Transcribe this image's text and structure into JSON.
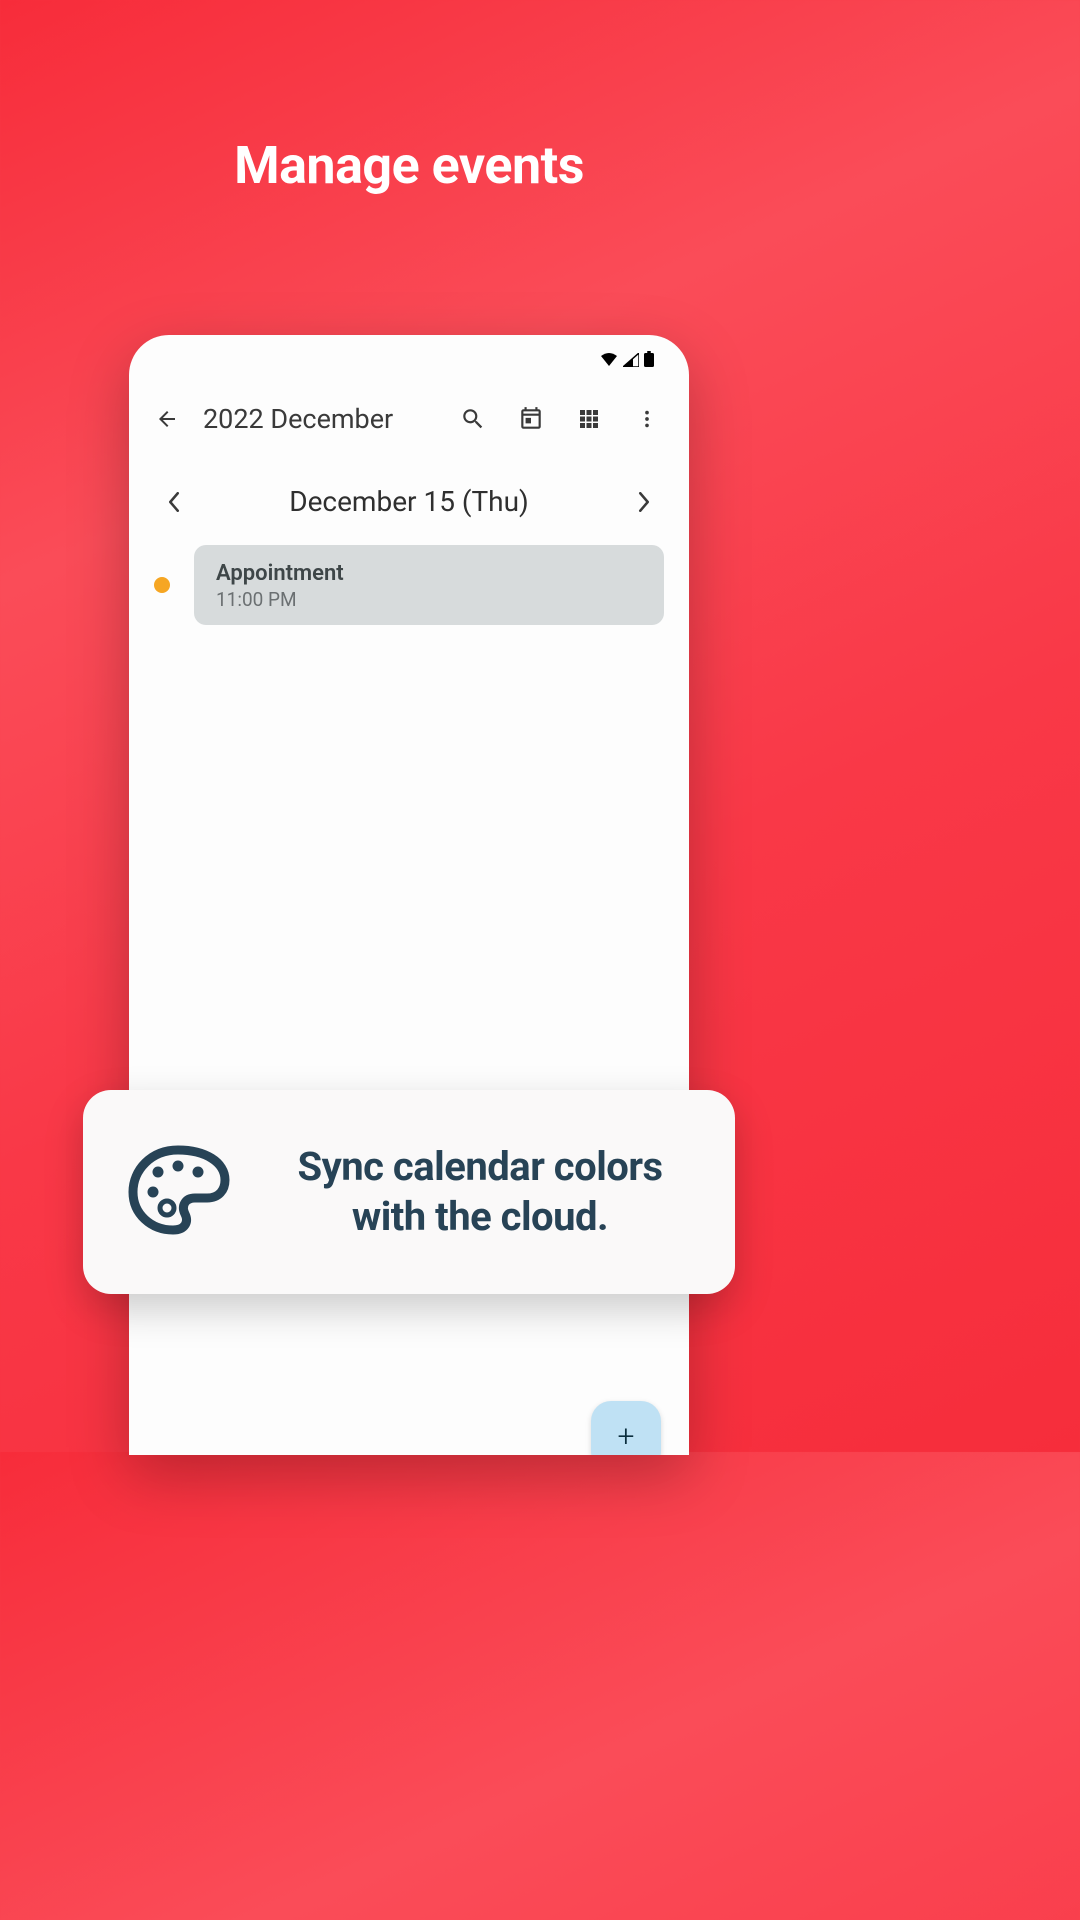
{
  "hero": {
    "title": "Manage events"
  },
  "toolbar": {
    "title": "2022 December"
  },
  "date_nav": {
    "label": "December 15 (Thu)"
  },
  "event": {
    "title": "Appointment",
    "time": "11:00 PM",
    "color": "#f6a623"
  },
  "promo": {
    "text": "Sync calendar colors with the cloud."
  },
  "fab": {
    "label": "+"
  }
}
